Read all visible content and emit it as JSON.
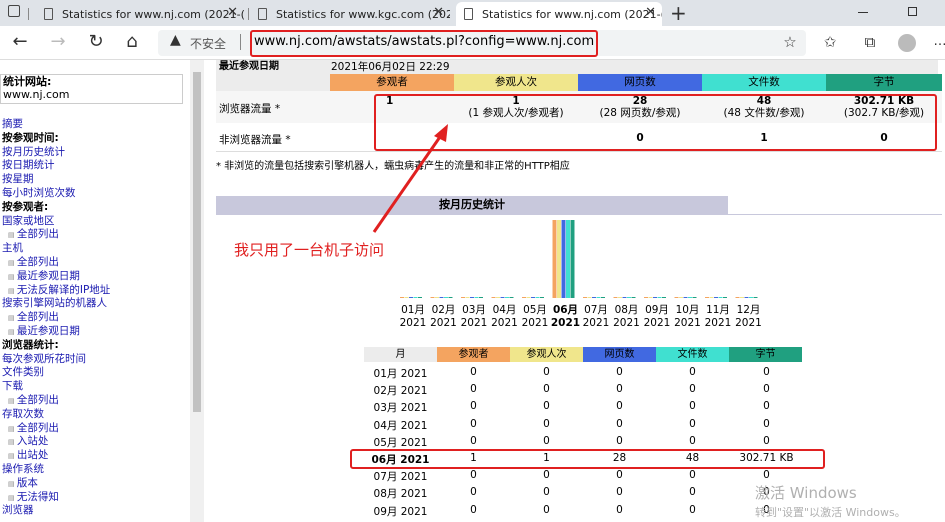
{
  "browser": {
    "tabs": [
      {
        "title": "Statistics for www.nj.com (2021-("
      },
      {
        "title": "Statistics for www.kgc.com (202"
      },
      {
        "title": "Statistics for www.nj.com (2021-("
      }
    ],
    "new_tab": "+",
    "insecure_label": "不安全",
    "url": "www.nj.com/awstats/awstats.pl?config=www.nj.com"
  },
  "sidebar": {
    "site_label": "统计网站:",
    "site_value": "www.nj.com",
    "items": [
      {
        "label": "摘要",
        "style": "link"
      },
      {
        "label": "按参观时间:",
        "style": "bold"
      },
      {
        "label": "按月历史统计",
        "style": "link"
      },
      {
        "label": "按日期统计",
        "style": "link"
      },
      {
        "label": "按星期",
        "style": "link"
      },
      {
        "label": "每小时浏览次数",
        "style": "link"
      },
      {
        "label": "按参观者:",
        "style": "bold"
      },
      {
        "label": "国家或地区",
        "style": "link"
      },
      {
        "label": "全部列出",
        "style": "sub"
      },
      {
        "label": "主机",
        "style": "link"
      },
      {
        "label": "全部列出",
        "style": "sub"
      },
      {
        "label": "最近参观日期",
        "style": "sub"
      },
      {
        "label": "无法反解译的IP地址",
        "style": "sub"
      },
      {
        "label": "搜索引擎网站的机器人",
        "style": "link"
      },
      {
        "label": "全部列出",
        "style": "sub"
      },
      {
        "label": "最近参观日期",
        "style": "sub"
      },
      {
        "label": "浏览器统计:",
        "style": "bold"
      },
      {
        "label": "每次参观所花时间",
        "style": "link"
      },
      {
        "label": "文件类别",
        "style": "link"
      },
      {
        "label": "下载",
        "style": "link"
      },
      {
        "label": "全部列出",
        "style": "sub"
      },
      {
        "label": "存取次数",
        "style": "link"
      },
      {
        "label": "全部列出",
        "style": "sub"
      },
      {
        "label": "入站处",
        "style": "sub"
      },
      {
        "label": "出站处",
        "style": "sub"
      },
      {
        "label": "操作系统",
        "style": "link"
      },
      {
        "label": "版本",
        "style": "sub"
      },
      {
        "label": "无法得知",
        "style": "sub"
      },
      {
        "label": "浏览器",
        "style": "link"
      }
    ]
  },
  "summary": {
    "last_visit_label": "最近参观日期",
    "last_visit_value": "2021年06月02日 22:29",
    "columns": [
      {
        "label": "参观者",
        "color": "#f4a460"
      },
      {
        "label": "参观人次",
        "color": "#f0e68c"
      },
      {
        "label": "网页数",
        "color": "#4169e1"
      },
      {
        "label": "文件数",
        "color": "#40e0d0"
      },
      {
        "label": "字节",
        "color": "#20a080"
      }
    ],
    "viewed_label": "浏览器流量 *",
    "viewed": {
      "visitors": "1",
      "visits": "1",
      "visits_sub": "(1 参观人次/参观者)",
      "pages": "28",
      "pages_sub": "(28 网页数/参观)",
      "hits": "48",
      "hits_sub": "(48 文件数/参观)",
      "bytes": "302.71 KB",
      "bytes_sub": "(302.7 KB/参观)"
    },
    "not_viewed_label": "非浏览器流量 *",
    "not_viewed": {
      "pages": "0",
      "hits": "1",
      "bytes": "0"
    },
    "note": "* 非浏览的流量包括搜索引擎机器人，蠕虫病毒产生的流量和非正常的HTTP相应"
  },
  "monthly": {
    "title": "按月历史统计",
    "months": [
      "01月",
      "02月",
      "03月",
      "04月",
      "05月",
      "06月",
      "07月",
      "08月",
      "09月",
      "10月",
      "11月",
      "12月"
    ],
    "year": "2021",
    "table_headers": [
      "月",
      "参观者",
      "参观人次",
      "网页数",
      "文件数",
      "字节"
    ],
    "rows": [
      [
        "01月 2021",
        "0",
        "0",
        "0",
        "0",
        "0"
      ],
      [
        "02月 2021",
        "0",
        "0",
        "0",
        "0",
        "0"
      ],
      [
        "03月 2021",
        "0",
        "0",
        "0",
        "0",
        "0"
      ],
      [
        "04月 2021",
        "0",
        "0",
        "0",
        "0",
        "0"
      ],
      [
        "05月 2021",
        "0",
        "0",
        "0",
        "0",
        "0"
      ],
      [
        "06月 2021",
        "1",
        "1",
        "28",
        "48",
        "302.71 KB"
      ],
      [
        "07月 2021",
        "0",
        "0",
        "0",
        "0",
        "0"
      ],
      [
        "08月 2021",
        "0",
        "0",
        "0",
        "0",
        "0"
      ],
      [
        "09月 2021",
        "0",
        "0",
        "0",
        "0",
        "0"
      ]
    ]
  },
  "annotation": "我只用了一台机子访问",
  "watermark": {
    "line1": "激活 Windows",
    "line2": "转到\"设置\"以激活 Windows。"
  }
}
